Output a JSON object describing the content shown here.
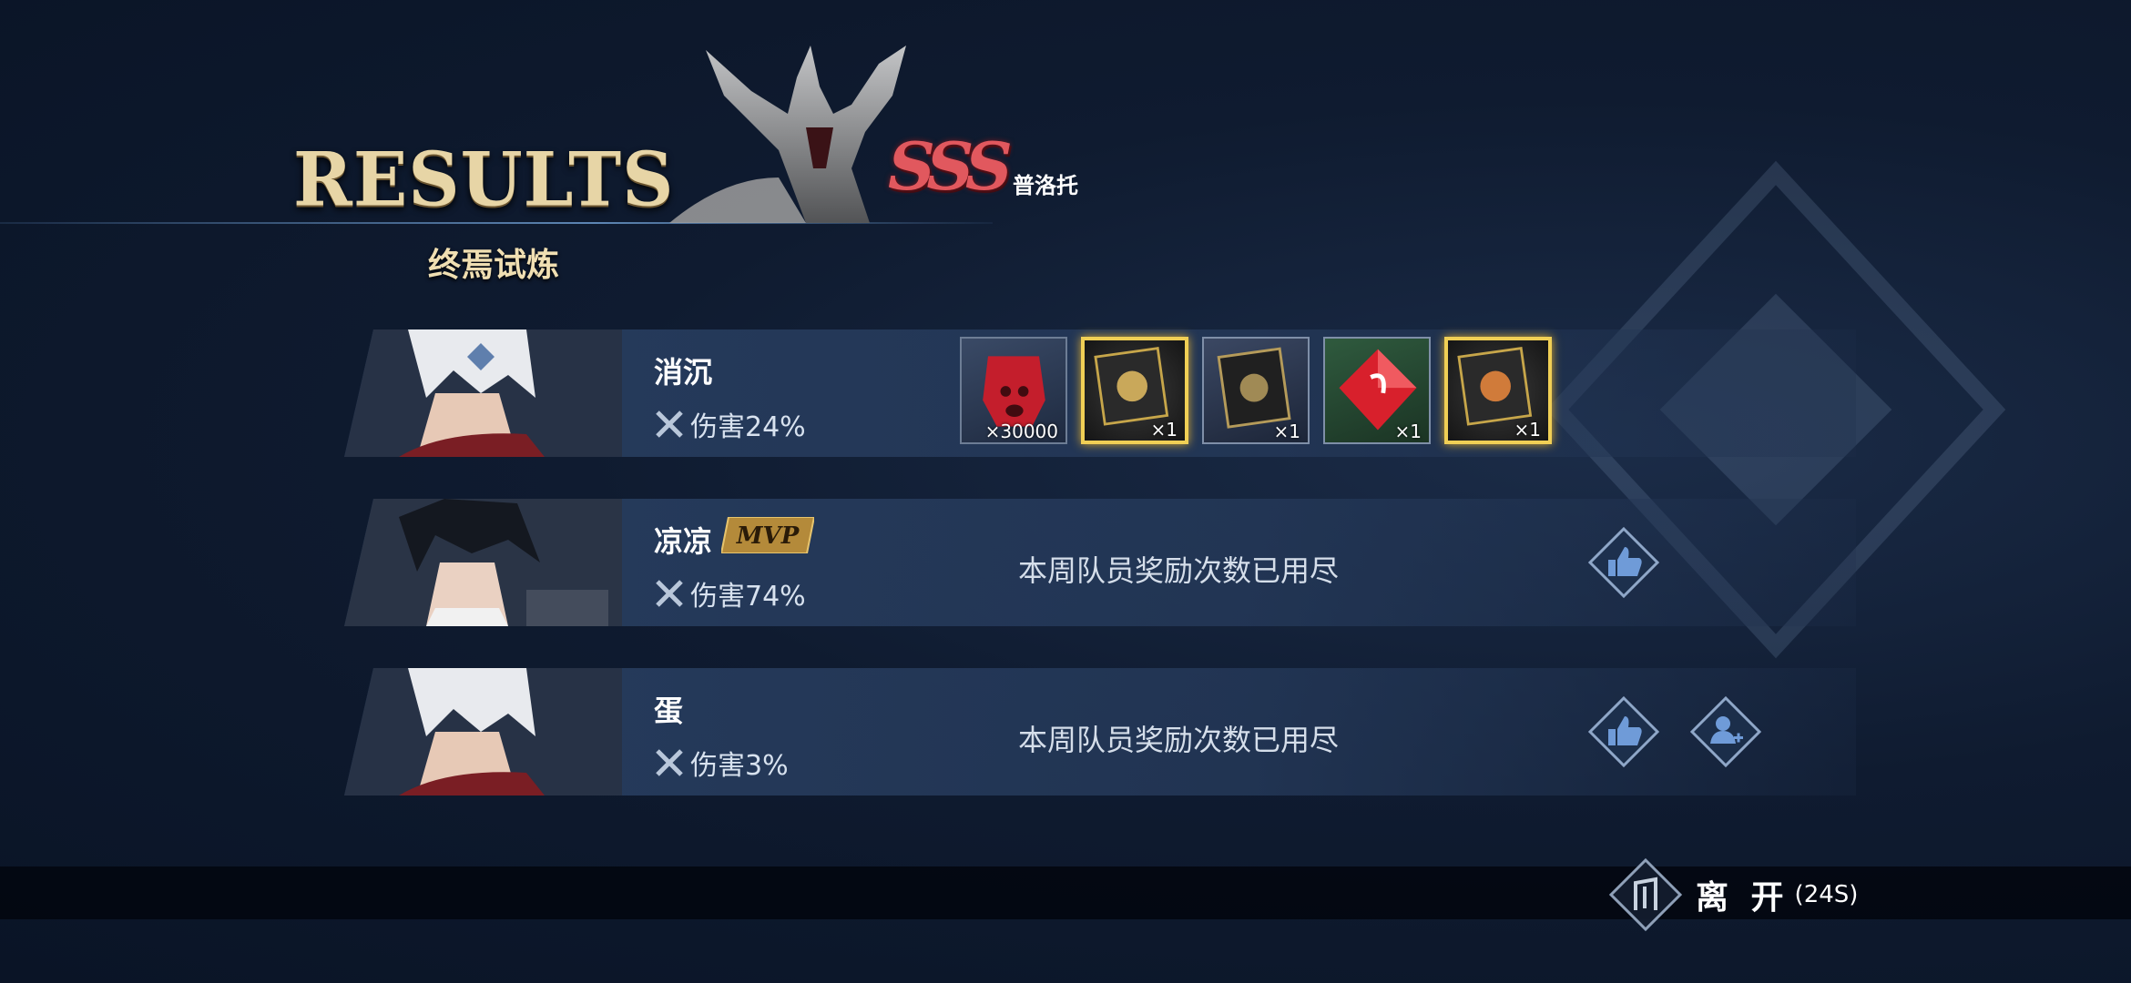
{
  "header": {
    "title": "RESULTS",
    "mode": "终焉试炼",
    "rank": "SSS",
    "boss_name": "普洛托"
  },
  "players": [
    {
      "name": "消沉",
      "damage_label": "伤害24%",
      "mvp": false,
      "rewards": [
        {
          "type": "red-crystal",
          "qty": "×30000"
        },
        {
          "type": "gold-card",
          "qty": "×1"
        },
        {
          "type": "dark-card",
          "qty": "×1"
        },
        {
          "type": "red-gem",
          "qty": "×1"
        },
        {
          "type": "gold-card",
          "qty": "×1"
        }
      ]
    },
    {
      "name": "凉凉",
      "damage_label": "伤害74%",
      "mvp": true,
      "mvp_label": "MVP",
      "note": "本周队员奖励次数已用尽"
    },
    {
      "name": "蛋",
      "damage_label": "伤害3%",
      "mvp": false,
      "note": "本周队员奖励次数已用尽"
    }
  ],
  "footer": {
    "leave_label": "离 开",
    "timer": "(24S)"
  },
  "colors": {
    "accent": "#5d86b4",
    "gold": "#f0cf55",
    "rank_red": "#e1585e"
  }
}
